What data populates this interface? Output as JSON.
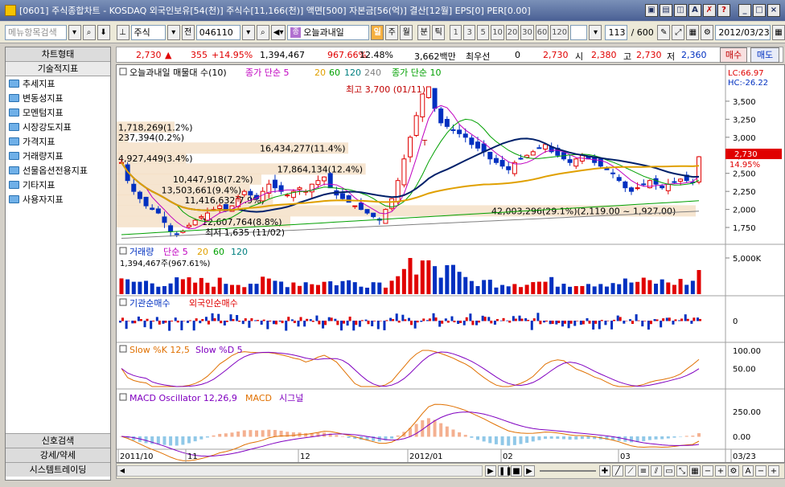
{
  "window": {
    "title": "[0601] 주식종합차트 - KOSDAQ 외국인보유[54(천)] 주식수[11,166(천)] 액면[500] 자본금[56(억)] 결산[12월] EPS[0] PER[0.00]"
  },
  "toolbar": {
    "menu_search_placeholder": "메뉴항목검색",
    "market_label": "주식",
    "prev_label": "전",
    "stock_code": "046110",
    "stock_name": "오늘과내일",
    "period_day": "일",
    "period_week": "주",
    "period_month": "월",
    "period_minute": "분",
    "period_tick": "틱",
    "intervals": [
      "1",
      "3",
      "5",
      "10",
      "20",
      "30",
      "60",
      "120"
    ],
    "count_value": "113",
    "count_total": "/ 600",
    "date_value": "2012/03/23"
  },
  "left_panel": {
    "header_tab": "차트형태",
    "sub_tab": "기술적지표",
    "items": [
      "추세지표",
      "변동성지표",
      "모멘텀지표",
      "시장강도지표",
      "가격지표",
      "거래량지표",
      "선물옵션전용지표",
      "기타지표",
      "사용자지표"
    ],
    "bottom_tabs": [
      "신호검색",
      "강세/약세",
      "시스템트레이딩"
    ]
  },
  "quote": {
    "price": "2,730",
    "change": "355",
    "change_pct": "+14.95%",
    "volume": "1,394,467",
    "volume_ratio": "967.66%",
    "turnover_pct": "12.48%",
    "trade_amount": "3,662백만",
    "best_quote_label": "최우선",
    "best_quote_value": "0",
    "best_quote_price": "2,730",
    "open_label": "시",
    "open": "2,380",
    "high_label": "고",
    "high": "2,730",
    "low_label": "저",
    "low": "2,360",
    "buy_button": "매수",
    "sell_button": "매도"
  },
  "price_panel": {
    "name_label": "오늘과내일 매물대 수(10)",
    "ma1_label": "종가 단순 5",
    "ma1_periods_extra": [
      "20",
      "60",
      "120",
      "240"
    ],
    "ma2_label": "종가 단순 10",
    "lc_label": "LC:66.97",
    "hc_label": "HC:-26.22",
    "high_marker": "최고 3,700 (01/11)",
    "low_marker": "최저 1,635 (11/02)",
    "current_price_tag": "2,730",
    "current_pct_tag": "14.95%",
    "t_markers": [
      "T",
      "T"
    ],
    "volume_profile": [
      "1,718,269(1.2%)",
      "237,394(0.2%)",
      "16,434,277(11.4%)",
      "4,927,449(3.4%)",
      "17,864,134(12.4%)",
      "10,447,918(7.2%)",
      "13,503,661(9.4%)",
      "11,416,632(7.9%)",
      "42,003,296(29.1%)(2,119.00 ~ 1,927.00)",
      "12,607,764(8.8%)"
    ],
    "y_ticks": [
      "3,500",
      "3,250",
      "3,000",
      "2,750",
      "2,500",
      "2,250",
      "2,000",
      "1,750"
    ]
  },
  "volume_panel": {
    "label": "거래량",
    "ma_label": "단순 5",
    "ma_extra": [
      "20",
      "60",
      "120"
    ],
    "value_label": "1,394,467주(967.61%)",
    "y_tick": "5,000K"
  },
  "netbuy_panel": {
    "label1": "기관순매수",
    "label2": "외국인순매수",
    "y_tick": "0"
  },
  "stoch_panel": {
    "label1": "Slow %K 12,5",
    "label2": "Slow %D 5",
    "y_ticks": [
      "100.00",
      "50.00"
    ]
  },
  "macd_panel": {
    "label1": "MACD Oscillator 12,26,9",
    "label2": "MACD",
    "label3": "시그널",
    "y_ticks": [
      "250.00",
      "0.00"
    ]
  },
  "x_axis": {
    "labels": [
      "2011/10",
      "11",
      "12",
      "2012/01",
      "02",
      "03",
      "03/23"
    ]
  },
  "chart_data": {
    "type": "candlestick",
    "x_range": [
      "2011/10",
      "2012/03/23"
    ],
    "ylim": [
      1635,
      3700
    ],
    "high": {
      "value": 3700,
      "date": "01/11"
    },
    "low": {
      "value": 1635,
      "date": "11/02"
    },
    "last": {
      "open": 2380,
      "high": 2730,
      "low": 2360,
      "close": 2730,
      "change_pct": 14.95
    },
    "closes_approx": [
      2650,
      2400,
      2250,
      2150,
      2050,
      2000,
      1950,
      1820,
      1700,
      1660,
      1700,
      1780,
      1850,
      1900,
      1950,
      2000,
      2050,
      1980,
      2050,
      2150,
      2250,
      2200,
      2150,
      2250,
      2350,
      2300,
      2250,
      2200,
      2250,
      2300,
      2250,
      2350,
      2400,
      2450,
      2300,
      2200,
      2150,
      2100,
      2050,
      2000,
      1950,
      1900,
      1850,
      2000,
      2150,
      2400,
      2700,
      3000,
      3300,
      3600,
      3700,
      3400,
      3200,
      3150,
      3100,
      3050,
      3000,
      2900,
      2850,
      2800,
      2700,
      2650,
      2600,
      2550,
      2650,
      2700,
      2750,
      2800,
      2850,
      2900,
      2800,
      2750,
      2700,
      2650,
      2700,
      2750,
      2700,
      2650,
      2600,
      2550,
      2500,
      2400,
      2300,
      2250,
      2300,
      2350,
      2400,
      2350,
      2300,
      2350,
      2380,
      2420,
      2400,
      2380,
      2730
    ]
  }
}
